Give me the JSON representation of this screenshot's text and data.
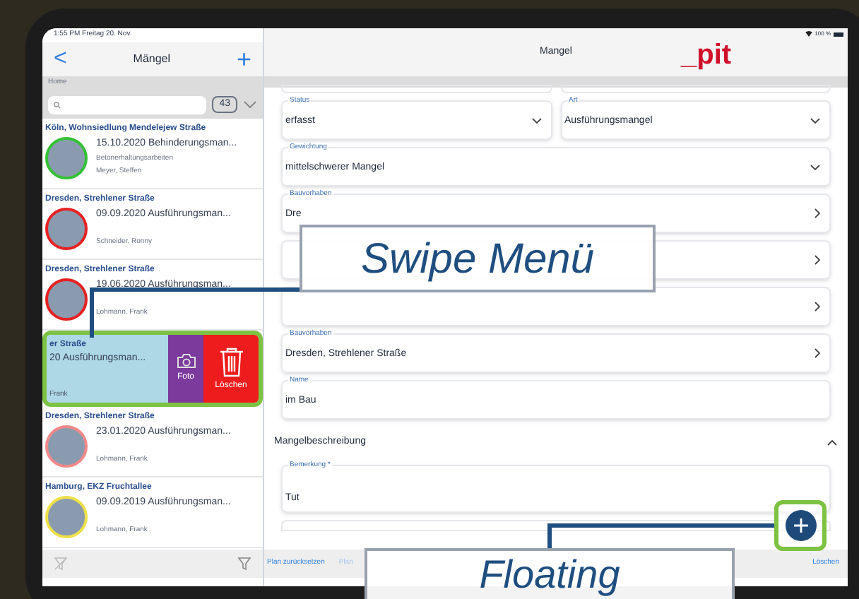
{
  "left_panel": {
    "status_bar": "1:55 PM  Freitag 20. Nov.",
    "back": "<",
    "title": "Mängel",
    "add": "+",
    "breadcrumb": "Home",
    "count": "43",
    "items": [
      {
        "kind": "normal",
        "title": "Köln, Wohnsiedlung Mendelejew Straße",
        "line1": "15.10.2020 Behinderungsman...",
        "line2": "Betonerhaltungsarbeiten",
        "person": "Meyer, Steffen",
        "color": "#35c135"
      },
      {
        "kind": "normal",
        "title": "Dresden, Strehlener Straße",
        "line1": "09.09.2020 Ausführungsman...",
        "person": "Schneider, Ronny",
        "color": "#e52222"
      },
      {
        "kind": "normal",
        "title": "Dresden, Strehlener Straße",
        "line1": "19.06.2020 Ausführungsman...",
        "person": "Lohmann, Frank",
        "color": "#e52222"
      },
      {
        "kind": "swiped",
        "title": "er Straße",
        "line1": "20 Ausführungsman...",
        "person": "Frank",
        "actions": [
          {
            "kind": "photo",
            "label": "Foto"
          },
          {
            "kind": "delete",
            "label": "Löschen"
          }
        ]
      },
      {
        "kind": "normal",
        "title": "Dresden, Strehlener Straße",
        "line1": "23.01.2020 Ausführungsman...",
        "person": "Lohmann, Frank",
        "color": "#f08a8a"
      },
      {
        "kind": "normal",
        "title": "Hamburg, EKZ Fruchtallee",
        "line1": "09.09.2019 Ausführungsman...",
        "person": "Lohmann, Frank",
        "color": "#eee04a"
      }
    ]
  },
  "detail": {
    "battery": "100 %",
    "title": "Mangel",
    "logo": "_pit",
    "rows": [
      [
        {
          "kind": "select",
          "label": "Status",
          "value": "erfasst"
        },
        {
          "kind": "select",
          "label": "Art",
          "value": "Ausführungsmangel"
        }
      ],
      [
        {
          "kind": "select",
          "label": "Gewichtung",
          "value": "mittelschwerer Mangel"
        }
      ],
      [
        {
          "kind": "link",
          "label": "Bauvorhaben",
          "value": "Dre"
        }
      ],
      [
        {
          "kind": "link"
        }
      ],
      [
        {
          "kind": "link"
        }
      ],
      [
        {
          "kind": "link",
          "label": "Bauvorhaben",
          "value": "Dresden, Strehlener Straße"
        }
      ],
      [
        {
          "kind": "text",
          "label": "Name",
          "value": "im Bau"
        }
      ]
    ],
    "section": {
      "title": "Mangelbeschreibung",
      "expanded": true
    },
    "remark": {
      "label": "Bemerkung *",
      "value": "Tut"
    },
    "toolbar": [
      "Plan zurücksetzen",
      "Plan",
      "Löschen"
    ]
  },
  "callouts": [
    "Swipe Menü",
    "Floating"
  ]
}
